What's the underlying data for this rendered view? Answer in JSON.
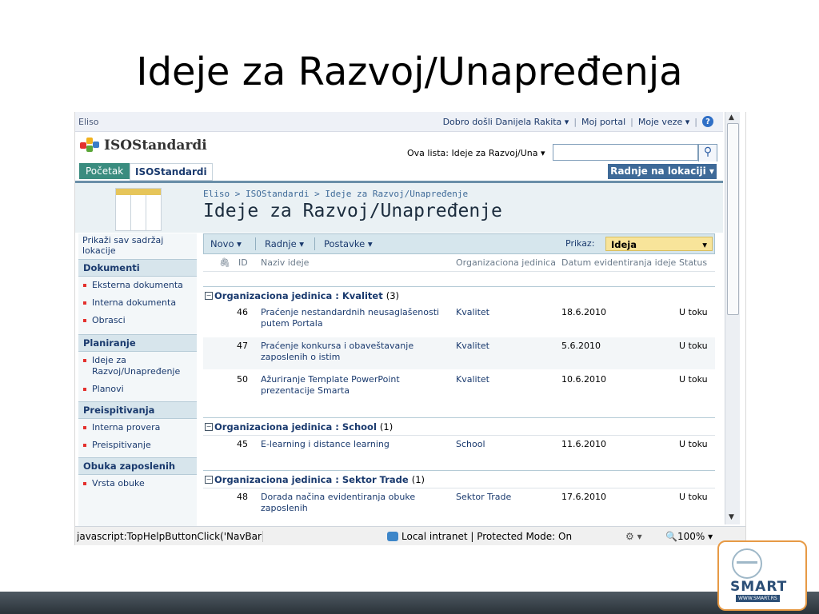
{
  "slide_title": "Ideje za Razvoj/Unapređenja",
  "topbar": {
    "site": "Eliso",
    "welcome": "Dobro došli Danijela Rakita ▾",
    "my_portal": "Moj portal",
    "my_links": "Moje veze ▾",
    "help": "?"
  },
  "header": {
    "logo_text": "ISOStandardi",
    "search_scope": "Ova lista: Ideje za Razvoj/Una ▾",
    "search_placeholder": ""
  },
  "nav": {
    "home": "Početak",
    "site": "ISOStandardi",
    "site_actions": "Radnje na lokaciji ▾"
  },
  "title_area": {
    "breadcrumb": "Eliso > ISOStandardi > Ideje za Razvoj/Unapređenje",
    "page_title": "Ideje za Razvoj/Unapređenje"
  },
  "quick_launch": {
    "view_all": "Prikaži sav sadržaj lokacije",
    "sections": [
      {
        "title": "Dokumenti",
        "items": [
          "Eksterna dokumenta",
          "Interna dokumenta",
          "Obrasci"
        ]
      },
      {
        "title": "Planiranje",
        "items": [
          "Ideje za Razvoj/Unapređenje",
          "Planovi"
        ]
      },
      {
        "title": "Preispitivanja",
        "items": [
          "Interna provera",
          "Preispitivanje"
        ]
      },
      {
        "title": "Obuka zaposlenih",
        "items": [
          "Vrsta obuke"
        ]
      }
    ]
  },
  "toolbar": {
    "new": "Novo ▾",
    "actions": "Radnje ▾",
    "settings": "Postavke ▾",
    "view_label": "Prikaz:",
    "view_value": "Ideja",
    "view_arrow": "▾"
  },
  "columns": {
    "attach": "🖇",
    "id": "ID",
    "name": "Naziv ideje",
    "org": "Organizaciona jedinica",
    "date": "Datum evidentiranja ideje",
    "status": "Status"
  },
  "groups": [
    {
      "label": "Organizaciona jedinica : Kvalitet",
      "count": "(3)"
    },
    {
      "label": "Organizaciona jedinica : School",
      "count": "(1)"
    },
    {
      "label": "Organizaciona jedinica : Sektor Trade",
      "count": "(1)"
    }
  ],
  "rows": [
    {
      "id": "46",
      "name": "Praćenje nestandardnih neusaglašenosti putem Portala",
      "org": "Kvalitet",
      "date": "18.6.2010",
      "status": "U toku"
    },
    {
      "id": "47",
      "name": "Praćenje konkursa i obaveštavanje zaposlenih o istim",
      "org": "Kvalitet",
      "date": "5.6.2010",
      "status": "U toku"
    },
    {
      "id": "50",
      "name": "Ažuriranje Template PowerPoint prezentacije Smarta",
      "org": "Kvalitet",
      "date": "10.6.2010",
      "status": "U toku"
    },
    {
      "id": "45",
      "name": "E-learning i distance learning",
      "org": "School",
      "date": "11.6.2010",
      "status": "U toku"
    },
    {
      "id": "48",
      "name": "Dorada načina evidentiranja obuke zaposlenih",
      "org": "Sektor Trade",
      "date": "17.6.2010",
      "status": "U toku"
    }
  ],
  "statusbar": {
    "js": "javascript:TopHelpButtonClick('NavBarHe",
    "zone": "Local intranet | Protected Mode: On",
    "zoom": "🔍100%  ▾",
    "prot_icons": "⚙ ▾"
  },
  "logo_badge": {
    "word": "SMART",
    "small": "WWW.SMART.RS"
  }
}
